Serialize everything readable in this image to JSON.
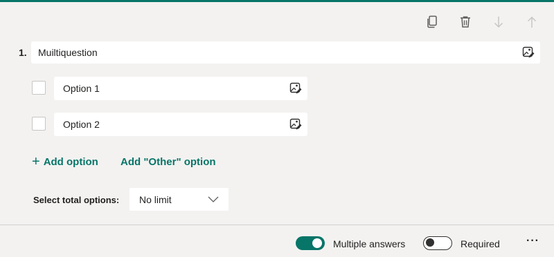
{
  "question": {
    "number": "1.",
    "title": "Muiltiquestion",
    "options": [
      {
        "label": "Option 1"
      },
      {
        "label": "Option 2"
      }
    ]
  },
  "actions": {
    "add_option": "Add option",
    "add_other": "Add \"Other\" option"
  },
  "select_total": {
    "label": "Select total options:",
    "value": "No limit"
  },
  "footer": {
    "multiple_answers": {
      "label": "Multiple answers",
      "on": true
    },
    "required": {
      "label": "Required",
      "on": false
    },
    "more": "···"
  },
  "toolbar_icons": [
    "copy-icon",
    "delete-icon",
    "move-down-icon",
    "move-up-icon"
  ],
  "colors": {
    "accent": "#077568",
    "background": "#f3f2f1"
  }
}
